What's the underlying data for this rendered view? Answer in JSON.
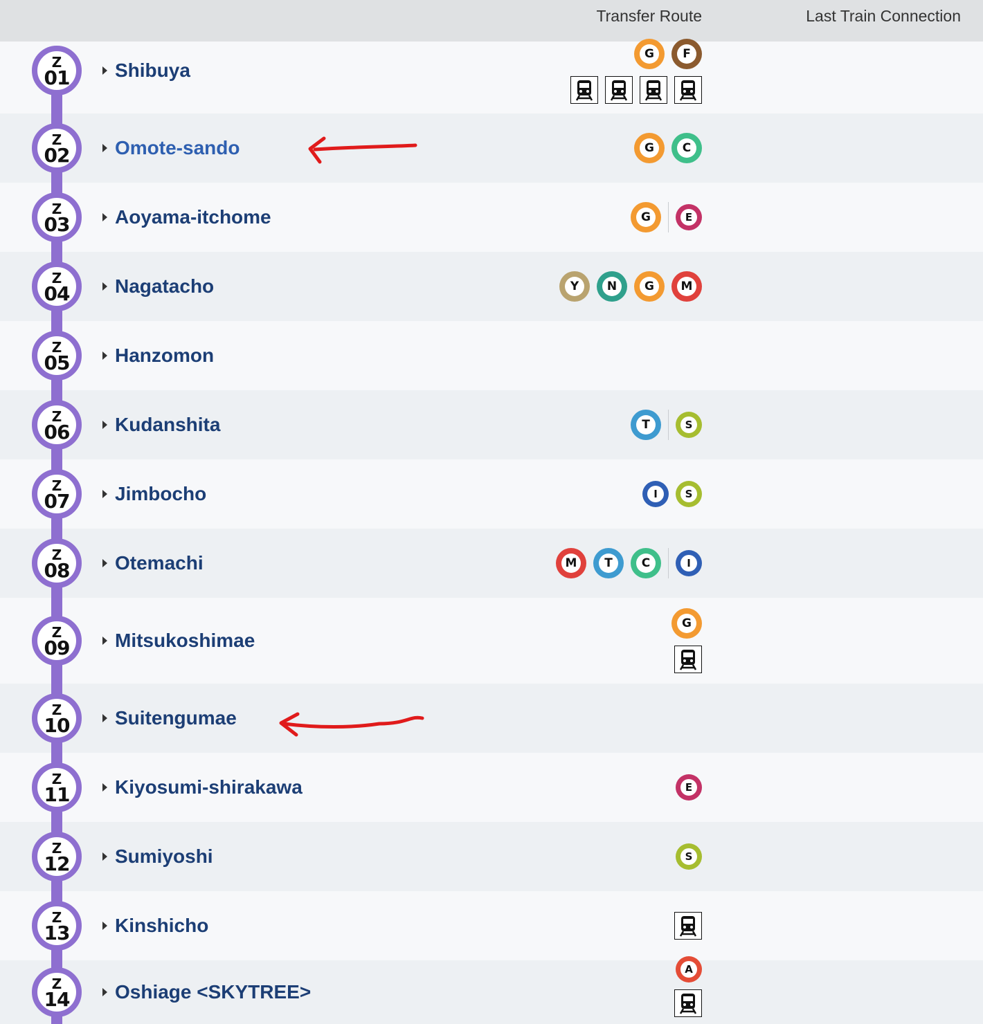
{
  "header": {
    "transfer_route": "Transfer Route",
    "last_train_connection": "Last Train Connection"
  },
  "colors": {
    "line": "#8e6fd0",
    "G": "#f39a31",
    "F": "#8b5a2e",
    "C": "#3fbf8a",
    "E": "#c33266",
    "Y": "#b9a36f",
    "N": "#2fa08c",
    "M": "#e0413c",
    "T": "#3e9bd0",
    "S": "#a6bd30",
    "I": "#2f5fb5",
    "A": "#e44c36"
  },
  "stations": [
    {
      "letter": "Z",
      "num": "01",
      "name": "Shibuya",
      "transfers": [
        [
          {
            "type": "line",
            "code": "G"
          },
          {
            "type": "line",
            "code": "F"
          }
        ],
        [
          {
            "type": "train"
          },
          {
            "type": "train"
          },
          {
            "type": "train"
          },
          {
            "type": "train"
          }
        ]
      ]
    },
    {
      "letter": "Z",
      "num": "02",
      "name": "Omote-sando",
      "highlight": true,
      "transfers": [
        [
          {
            "type": "line",
            "code": "G"
          },
          {
            "type": "line",
            "code": "C"
          }
        ]
      ]
    },
    {
      "letter": "Z",
      "num": "03",
      "name": "Aoyama-itchome",
      "transfers": [
        [
          {
            "type": "line",
            "code": "G"
          },
          {
            "type": "sep"
          },
          {
            "type": "line",
            "code": "E",
            "small": true
          }
        ]
      ]
    },
    {
      "letter": "Z",
      "num": "04",
      "name": "Nagatacho",
      "transfers": [
        [
          {
            "type": "line",
            "code": "Y"
          },
          {
            "type": "line",
            "code": "N"
          },
          {
            "type": "line",
            "code": "G"
          },
          {
            "type": "line",
            "code": "M"
          }
        ]
      ]
    },
    {
      "letter": "Z",
      "num": "05",
      "name": "Hanzomon",
      "transfers": []
    },
    {
      "letter": "Z",
      "num": "06",
      "name": "Kudanshita",
      "transfers": [
        [
          {
            "type": "line",
            "code": "T"
          },
          {
            "type": "sep"
          },
          {
            "type": "line",
            "code": "S",
            "small": true
          }
        ]
      ]
    },
    {
      "letter": "Z",
      "num": "07",
      "name": "Jimbocho",
      "transfers": [
        [
          {
            "type": "line",
            "code": "I",
            "small": true
          },
          {
            "type": "line",
            "code": "S",
            "small": true
          }
        ]
      ]
    },
    {
      "letter": "Z",
      "num": "08",
      "name": "Otemachi",
      "transfers": [
        [
          {
            "type": "line",
            "code": "M"
          },
          {
            "type": "line",
            "code": "T"
          },
          {
            "type": "line",
            "code": "C"
          },
          {
            "type": "sep"
          },
          {
            "type": "line",
            "code": "I",
            "small": true
          }
        ]
      ]
    },
    {
      "letter": "Z",
      "num": "09",
      "name": "Mitsukoshimae",
      "transfers": [
        [
          {
            "type": "line",
            "code": "G"
          }
        ],
        [
          {
            "type": "train"
          }
        ]
      ]
    },
    {
      "letter": "Z",
      "num": "10",
      "name": "Suitengumae",
      "transfers": []
    },
    {
      "letter": "Z",
      "num": "11",
      "name": "Kiyosumi-shirakawa",
      "transfers": [
        [
          {
            "type": "line",
            "code": "E",
            "small": true
          }
        ]
      ]
    },
    {
      "letter": "Z",
      "num": "12",
      "name": "Sumiyoshi",
      "transfers": [
        [
          {
            "type": "line",
            "code": "S",
            "small": true
          }
        ]
      ]
    },
    {
      "letter": "Z",
      "num": "13",
      "name": "Kinshicho",
      "transfers": [
        [
          {
            "type": "train"
          }
        ]
      ]
    },
    {
      "letter": "Z",
      "num": "14",
      "name": "Oshiage <SKYTREE>",
      "transfers": [
        [
          {
            "type": "line",
            "code": "A",
            "small": true
          }
        ],
        [
          {
            "type": "train"
          }
        ]
      ]
    }
  ]
}
